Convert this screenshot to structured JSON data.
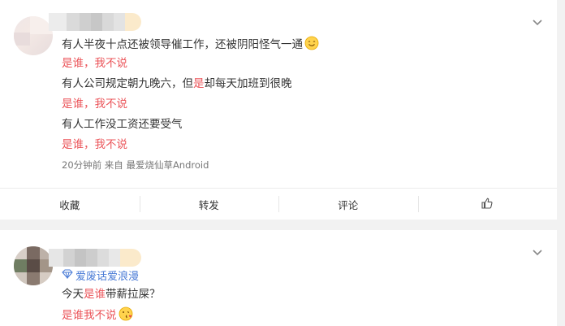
{
  "post1": {
    "lines": [
      {
        "text": "有人半夜十点还被领导催工作，还被阴阳怪气一通",
        "color": "#333333"
      },
      {
        "text": "是谁，我不说",
        "color": "#eb5459"
      },
      {
        "text_a": "有人公司规定朝九晚六，但",
        "text_b": "是",
        "text_c": "却每天加班到很晚"
      },
      {
        "text": "是谁，我不说",
        "color": "#eb5459"
      },
      {
        "text": "有人工作没工资还要受气",
        "color": "#333333"
      },
      {
        "text": "是谁，我不说",
        "color": "#eb5459"
      }
    ],
    "meta": "20分钟前  来自 最爱烧仙草Android",
    "emoji": "smile-emoji"
  },
  "actions": [
    "收藏",
    "转发",
    "评论"
  ],
  "like_icon": "thumbs-up-icon",
  "post2": {
    "badge": "爱废话爱浪漫",
    "badge_icon": "diamond-icon",
    "line1_a": "今天",
    "line1_b": "是谁",
    "line1_c": "带薪拉屎？",
    "line2": "是谁我不说",
    "emoji": "kiss-emoji"
  },
  "colors": {
    "accent_red": "#eb5459",
    "link_blue": "#4a7bd6",
    "background": "#f2f2f2"
  }
}
